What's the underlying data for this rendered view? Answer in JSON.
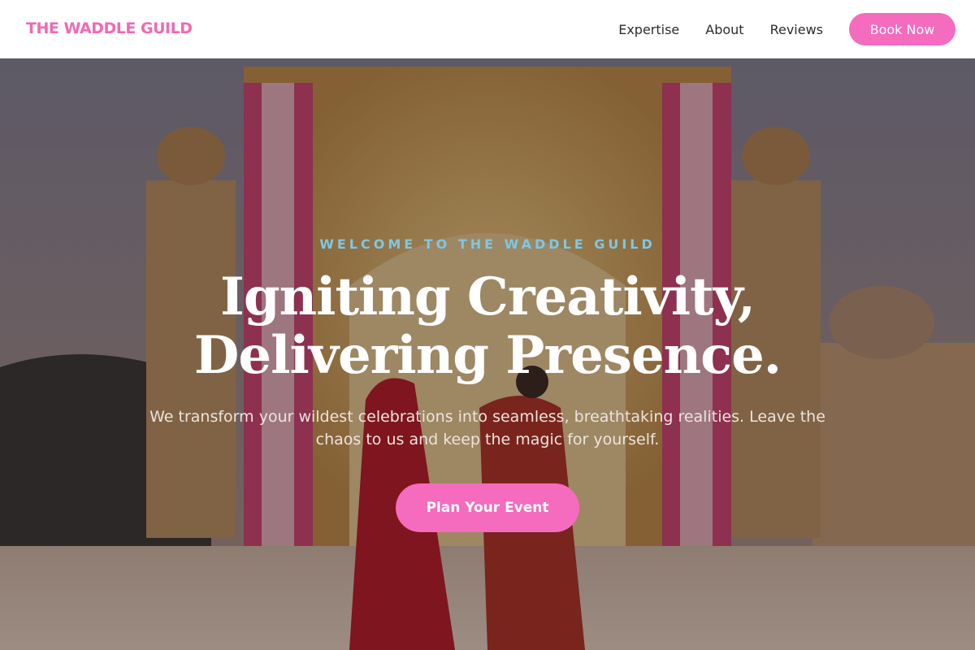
{
  "header": {
    "logo": "THE WADDLE GUILD",
    "nav": [
      {
        "label": "Expertise"
      },
      {
        "label": "About"
      },
      {
        "label": "Reviews"
      }
    ],
    "book_button": "Book Now"
  },
  "hero": {
    "eyebrow": "WELCOME TO THE WADDLE GUILD",
    "headline_line1": "Igniting Creativity,",
    "headline_line2": "Delivering Presence.",
    "subtitle": "We transform your wildest celebrations into seamless, breathtaking realities. Leave the chaos to us and keep the magic for yourself.",
    "cta": "Plan Your Event"
  },
  "colors": {
    "accent_pink": "#f56bbd",
    "logo_pink": "#f06ab4",
    "eyebrow_blue": "#7cc8e6"
  }
}
